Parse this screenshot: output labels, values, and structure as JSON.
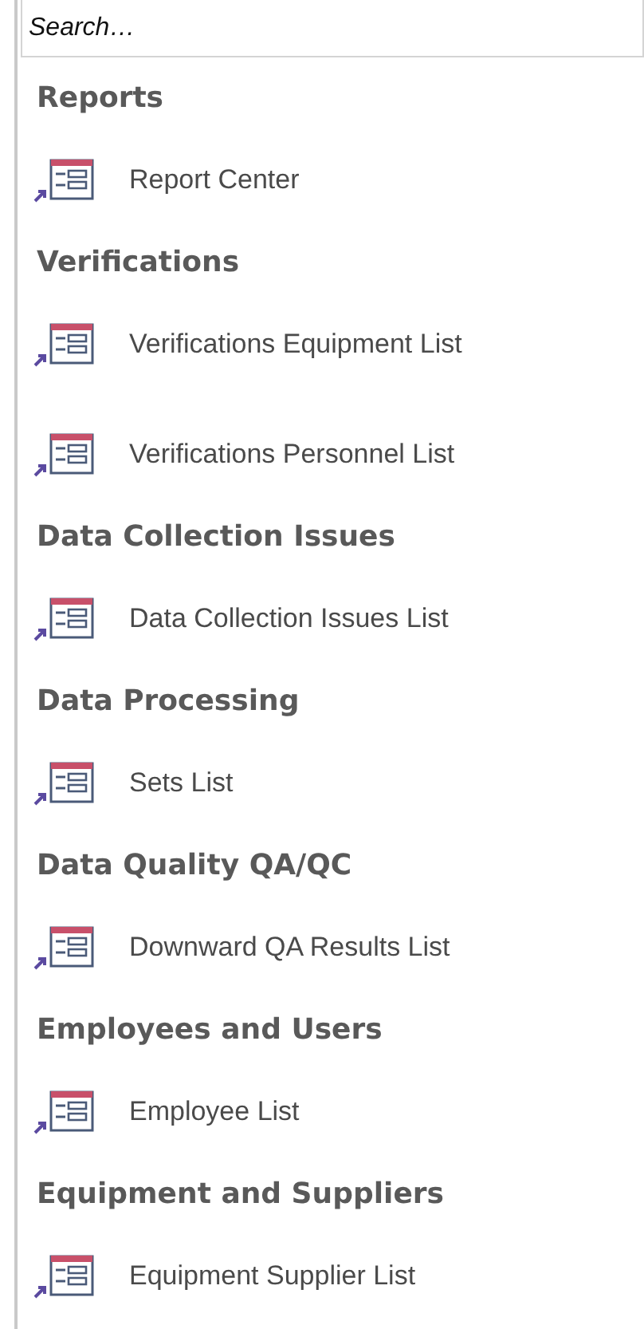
{
  "search": {
    "placeholder": "Search…"
  },
  "groups": [
    {
      "title": "Reports",
      "items": [
        {
          "label": "Report Center"
        }
      ]
    },
    {
      "title": "Verifications",
      "items": [
        {
          "label": "Verifications Equipment List"
        },
        {
          "label": "Verifications Personnel List"
        }
      ]
    },
    {
      "title": "Data Collection Issues",
      "items": [
        {
          "label": "Data Collection Issues List"
        }
      ]
    },
    {
      "title": "Data Processing",
      "items": [
        {
          "label": "Sets List"
        }
      ]
    },
    {
      "title": "Data Quality QA/QC",
      "items": [
        {
          "label": "Downward QA Results List"
        }
      ]
    },
    {
      "title": "Employees and Users",
      "items": [
        {
          "label": "Employee List"
        }
      ]
    },
    {
      "title": "Equipment and Suppliers",
      "items": [
        {
          "label": "Equipment Supplier List"
        }
      ]
    }
  ]
}
